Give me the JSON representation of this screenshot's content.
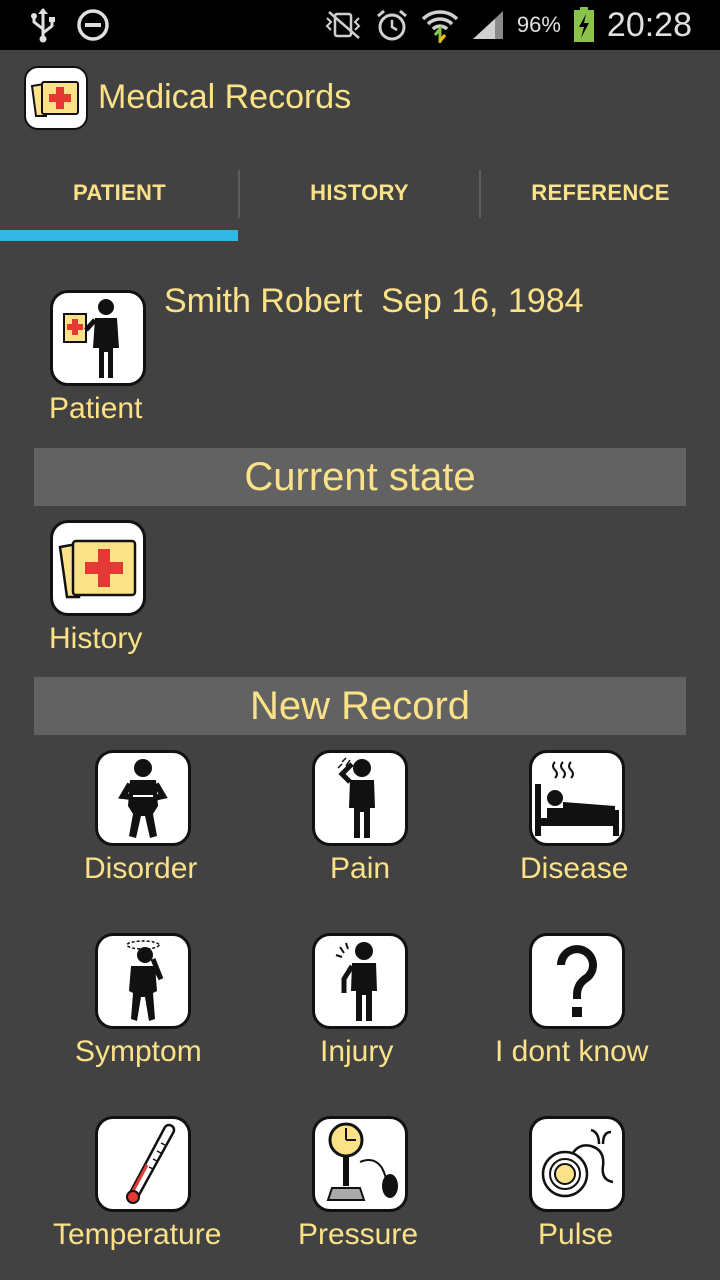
{
  "status_bar": {
    "battery_percent": "96%",
    "time": "20:28",
    "icons": [
      "usb-icon",
      "do-not-disturb-icon",
      "mute-vibrate-icon",
      "alarm-icon",
      "wifi-icon",
      "signal-icon",
      "battery-charging-icon"
    ]
  },
  "app": {
    "title": "Medical Records",
    "icon": "medical-folder-icon"
  },
  "tabs": [
    {
      "label": "PATIENT",
      "selected": true
    },
    {
      "label": "HISTORY",
      "selected": false
    },
    {
      "label": "REFERENCE",
      "selected": false
    }
  ],
  "patient": {
    "tile_label": "Patient",
    "name_and_dob": "Smith Robert  Sep 16, 1984",
    "icon": "patient-with-chart-icon"
  },
  "current_state": {
    "header": "Current state",
    "history_label": "History",
    "history_icon": "medical-folder-icon"
  },
  "new_record": {
    "header": "New Record",
    "items": [
      {
        "label": "Disorder",
        "icon": "stomach-ache-person-icon"
      },
      {
        "label": "Pain",
        "icon": "headache-person-icon"
      },
      {
        "label": "Disease",
        "icon": "person-in-bed-icon"
      },
      {
        "label": "Symptom",
        "icon": "dizzy-person-icon"
      },
      {
        "label": "Injury",
        "icon": "injured-person-icon"
      },
      {
        "label": "I dont know",
        "icon": "question-mark-icon"
      },
      {
        "label": "Temperature",
        "icon": "thermometer-icon"
      },
      {
        "label": "Pressure",
        "icon": "blood-pressure-gauge-icon"
      },
      {
        "label": "Pulse",
        "icon": "stethoscope-icon"
      }
    ]
  },
  "colors": {
    "background": "#424242",
    "text": "#fbe289",
    "accent": "#33b5e5",
    "section_header_bg": "#626262",
    "medical_red": "#e53935",
    "folder_yellow": "#fbe289"
  }
}
